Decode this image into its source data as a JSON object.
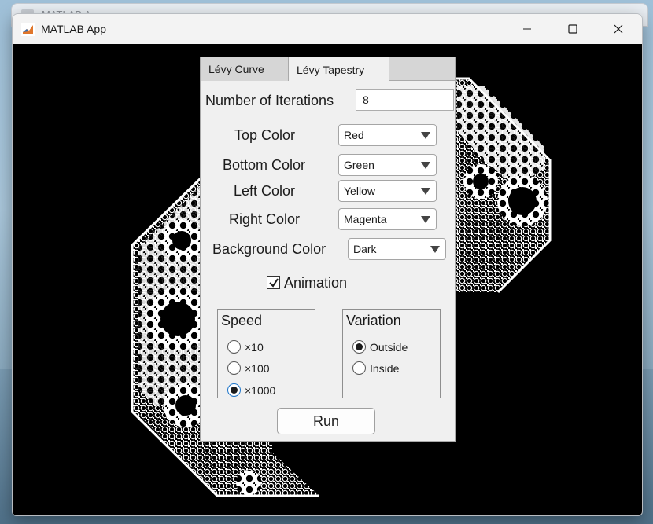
{
  "back_window": {
    "title": "MATLAB A"
  },
  "window": {
    "title": "MATLAB App",
    "controls": {
      "minimize": "—",
      "maximize": "☐",
      "close": "✕"
    }
  },
  "tabs": [
    {
      "label": "Lévy Curve",
      "selected": false
    },
    {
      "label": "Lévy Tapestry",
      "selected": true
    }
  ],
  "form": {
    "iterations_label": "Number of Iterations",
    "iterations_value": "8",
    "top_color_label": "Top Color",
    "top_color_value": "Red",
    "bottom_color_label": "Bottom Color",
    "bottom_color_value": "Green",
    "left_color_label": "Left Color",
    "left_color_value": "Yellow",
    "right_color_label": "Right Color",
    "right_color_value": "Magenta",
    "background_color_label": "Background Color",
    "background_color_value": "Dark",
    "animation_label": "Animation",
    "animation_checked": true
  },
  "speed": {
    "title": "Speed",
    "options": [
      "×10",
      "×100",
      "×1000"
    ],
    "selected": "×1000"
  },
  "variation": {
    "title": "Variation",
    "options": [
      "Outside",
      "Inside"
    ],
    "selected": "Outside"
  },
  "run_label": "Run",
  "colors": {
    "canvas": "#000000",
    "fractal": "#ffffff",
    "panel": "#f0f0f0"
  }
}
